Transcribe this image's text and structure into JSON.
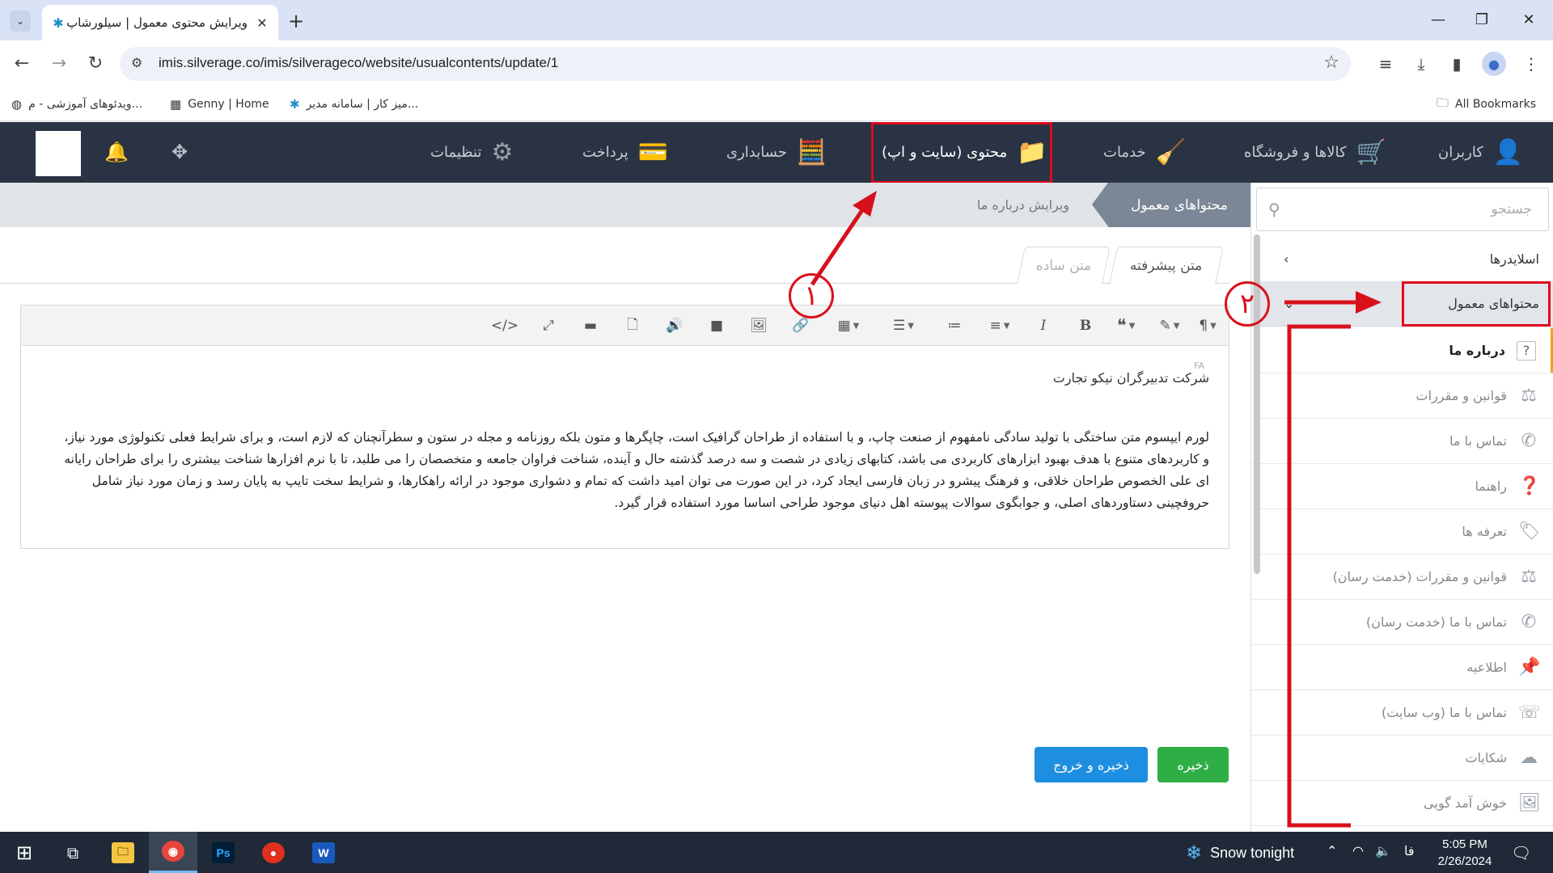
{
  "browser": {
    "tab_title": "ویرایش محتوی معمول | سیلورشاپ",
    "url": "imis.silverage.co/imis/silverageco/website/usualcontents/update/1",
    "bookmarks": [
      {
        "label": "ویدئوهای آموزشی - م...",
        "icon": "globe-icon"
      },
      {
        "label": "Genny | Home",
        "icon": "genny-icon"
      },
      {
        "label": "میز کار | سامانه مدیر...",
        "icon": "silverage-icon"
      }
    ],
    "all_bookmarks": "All Bookmarks"
  },
  "nav": {
    "users": "کاربران",
    "products": "کالاها و فروشگاه",
    "services": "خدمات",
    "content": "محتوی (سایت و اپ)",
    "accounting": "حسابداری",
    "payment": "پرداخت",
    "settings": "تنظیمات"
  },
  "breadcrumb": {
    "active": "محتواهای معمول",
    "current": "ویرایش درباره ما"
  },
  "sidebar": {
    "search_placeholder": "جستجو",
    "groups": {
      "sliders": "اسلایدرها",
      "usual_contents": "محتواهای معمول"
    },
    "items": [
      {
        "label": "درباره ما",
        "icon": "question-icon",
        "active": true
      },
      {
        "label": "قوانین و مقررات",
        "icon": "scale-icon"
      },
      {
        "label": "تماس با ما",
        "icon": "phone-icon"
      },
      {
        "label": "راهنما",
        "icon": "help-circle-icon"
      },
      {
        "label": "تعرفه ها",
        "icon": "tag-icon"
      },
      {
        "label": "قوانین و مقررات (خدمت رسان)",
        "icon": "scale-icon"
      },
      {
        "label": "تماس با ما (خدمت رسان)",
        "icon": "phone-icon"
      },
      {
        "label": "اطلاعیه",
        "icon": "pin-icon"
      },
      {
        "label": "تماس با ما (وب سایت)",
        "icon": "phone-web-icon"
      },
      {
        "label": "شکایات",
        "icon": "cloud-icon"
      },
      {
        "label": "خوش آمد گویی",
        "icon": "image-icon"
      }
    ]
  },
  "editor": {
    "tabs": {
      "advanced": "متن پیشرفته",
      "plain": "متن ساده"
    },
    "lang_tag": "FA",
    "heading": "شرکت تدبیرگران نیکو تجارت",
    "paragraph": "لورم ایپسوم متن ساختگی با تولید سادگی نامفهوم از صنعت چاپ، و با استفاده از طراحان گرافیک است، چاپگرها و متون بلکه روزنامه و مجله در ستون و سطرآنچنان که لازم است، و برای شرایط فعلی تکنولوژی مورد نیاز، و کاربردهای متنوع با هدف بهبود ابزارهای کاربردی می باشد، کتابهای زیادی در شصت و سه درصد گذشته حال و آینده، شناخت فراوان جامعه و متخصصان را می طلبد، تا با نرم افزارها شناخت بیشتری را برای طراحان رایانه ای علی الخصوص طراحان خلاقی، و فرهنگ پیشرو در زبان فارسی ایجاد کرد، در این صورت می توان امید داشت که تمام و دشواری موجود در ارائه راهکارها، و شرایط سخت تایپ به پایان رسد و زمان مورد نیاز شامل حروفچینی دستاوردهای اصلی، و جوابگوی سوالات پیوسته اهل دنیای موجود طراحی اساسا مورد استفاده قرار گیرد."
  },
  "actions": {
    "save": "ذخیره",
    "save_exit": "ذخیره و خروج"
  },
  "annotations": {
    "one": "١",
    "two": "٢"
  },
  "taskbar": {
    "weather": "Snow tonight",
    "lang": "فا",
    "time": "5:05 PM",
    "date": "2/26/2024"
  },
  "colors": {
    "app_header": "#2a3343",
    "highlight": "#e0081c",
    "save_button": "#2fae45",
    "save_exit_button": "#1e8fe0",
    "active_crumb": "#7b8796"
  }
}
